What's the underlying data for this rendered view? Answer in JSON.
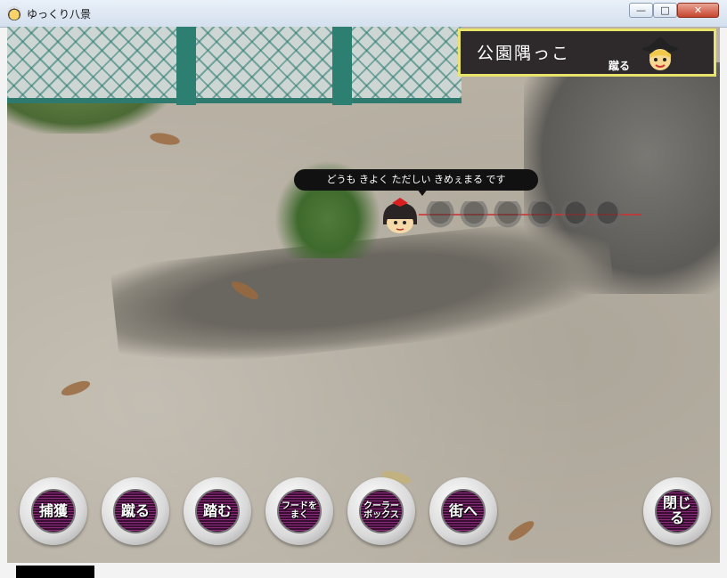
{
  "window": {
    "title": "ゆっくり八景",
    "buttons": {
      "minimize": "—",
      "maximize": "□",
      "close": "✕"
    }
  },
  "location_panel": {
    "name": "公園隅っこ",
    "action_tag": "蹴る"
  },
  "speech": {
    "text": "どうも きよく ただしい  きめぇまる です"
  },
  "commands": [
    {
      "label": "捕獲"
    },
    {
      "label": "蹴る"
    },
    {
      "label": "踏む"
    },
    {
      "label": "フードを\nまく"
    },
    {
      "label": "クーラー\nボックス"
    },
    {
      "label": "街へ"
    },
    {
      "label": "閉じる"
    }
  ],
  "icons": [
    "app-icon",
    "marisa-face-icon",
    "reimu-yukkuri-icon"
  ]
}
